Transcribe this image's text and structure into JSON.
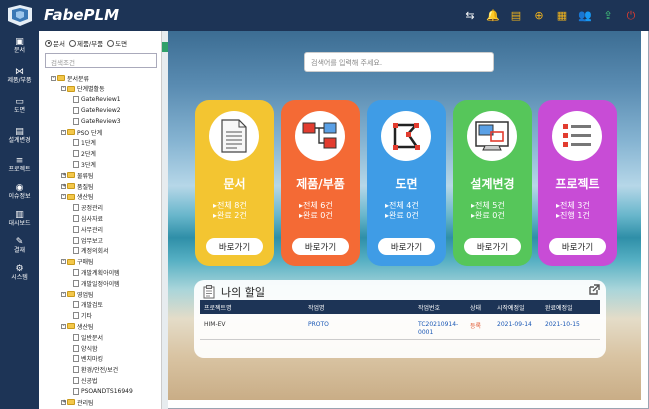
{
  "app": {
    "brand": "FabePLM"
  },
  "topbar": {
    "icons": [
      "swap-icon",
      "bell-icon",
      "clipboard-icon",
      "globe-icon",
      "calendar-icon",
      "user-group-icon",
      "export-icon",
      "power-icon"
    ],
    "icon_glyphs": [
      "⇆",
      "🔔",
      "▤",
      "⊕",
      "▦",
      "👥",
      "⇪",
      "⏻"
    ],
    "colors": {
      "bar": "#1d3456",
      "accent": "#f1b31c",
      "power": "#e23c2f"
    }
  },
  "rail": [
    {
      "label": "문서",
      "glyph": "▣"
    },
    {
      "label": "제품/부품",
      "glyph": "⋈"
    },
    {
      "label": "도면",
      "glyph": "▭"
    },
    {
      "label": "설계변경",
      "glyph": "▤"
    },
    {
      "label": "프로젝트",
      "glyph": "≡"
    },
    {
      "label": "이슈정보",
      "glyph": "◉"
    },
    {
      "label": "대시보드",
      "glyph": "▥"
    },
    {
      "label": "결재",
      "glyph": "✎"
    },
    {
      "label": "시스템",
      "glyph": "⚙"
    }
  ],
  "tree": {
    "radio_doc": "문서",
    "radio_part": "제품/부품",
    "radio_drawing": "도면",
    "search_placeholder": "검색조건",
    "nodes": [
      {
        "label": "문서분류",
        "type": "folder",
        "level": 0,
        "pm": "-"
      },
      {
        "label": "단계별활동",
        "type": "folder",
        "level": 1,
        "pm": "-"
      },
      {
        "label": "GateReview1",
        "type": "doc",
        "level": 2
      },
      {
        "label": "GateReview2",
        "type": "doc",
        "level": 2
      },
      {
        "label": "GateReview3",
        "type": "doc",
        "level": 2
      },
      {
        "label": "PSO 단계",
        "type": "folder",
        "level": 1,
        "pm": "-"
      },
      {
        "label": "1단계",
        "type": "doc",
        "level": 2
      },
      {
        "label": "2단계",
        "type": "doc",
        "level": 2
      },
      {
        "label": "3단계",
        "type": "doc",
        "level": 2
      },
      {
        "label": "물류팀",
        "type": "folder",
        "level": 1,
        "pm": "+"
      },
      {
        "label": "품질팀",
        "type": "folder",
        "level": 1,
        "pm": "+"
      },
      {
        "label": "생산팀",
        "type": "folder",
        "level": 1,
        "pm": "-"
      },
      {
        "label": "공정관리",
        "type": "doc",
        "level": 2
      },
      {
        "label": "심사자료",
        "type": "doc",
        "level": 2
      },
      {
        "label": "사무관리",
        "type": "doc",
        "level": 2
      },
      {
        "label": "업무보고",
        "type": "doc",
        "level": 2
      },
      {
        "label": "계정의회서",
        "type": "doc",
        "level": 2
      },
      {
        "label": "구매팀",
        "type": "folder",
        "level": 1,
        "pm": "-"
      },
      {
        "label": "개발계획아이템",
        "type": "doc",
        "level": 2
      },
      {
        "label": "개발일정아이템",
        "type": "doc",
        "level": 2
      },
      {
        "label": "영업팀",
        "type": "folder",
        "level": 1,
        "pm": "-"
      },
      {
        "label": "개발검토",
        "type": "doc",
        "level": 2
      },
      {
        "label": "기타",
        "type": "doc",
        "level": 2
      },
      {
        "label": "생산팀",
        "type": "folder",
        "level": 1,
        "pm": "-"
      },
      {
        "label": "일반문서",
        "type": "doc",
        "level": 2
      },
      {
        "label": "양식함",
        "type": "doc",
        "level": 2
      },
      {
        "label": "벤치마킹",
        "type": "doc",
        "level": 2
      },
      {
        "label": "환경/안전/보건",
        "type": "doc",
        "level": 2
      },
      {
        "label": "신공법",
        "type": "doc",
        "level": 2
      },
      {
        "label": "PSOANDTS16949",
        "type": "doc",
        "level": 2
      },
      {
        "label": "관리팀",
        "type": "folder",
        "level": 1,
        "pm": "+"
      }
    ]
  },
  "main": {
    "search_placeholder": "검색어를 입력해 주세요.",
    "cards": [
      {
        "title": "문서",
        "stat1": "▸전체 8건",
        "stat2": "▸완료 2건",
        "button": "바로가기",
        "icon": "document-icon",
        "color": "#f3c531"
      },
      {
        "title": "제품/부품",
        "stat1": "▸전체 6건",
        "stat2": "▸완료 0건",
        "button": "바로가기",
        "icon": "product-tree-icon",
        "color": "#f46a35"
      },
      {
        "title": "도면",
        "stat1": "▸전체 4건",
        "stat2": "▸완료 0건",
        "button": "바로가기",
        "icon": "drawing-icon",
        "color": "#3f9ce6"
      },
      {
        "title": "설계변경",
        "stat1": "▸전체 5건",
        "stat2": "▸완료 0건",
        "button": "바로가기",
        "icon": "design-change-icon",
        "color": "#56c65a"
      },
      {
        "title": "프로젝트",
        "stat1": "▸전체 3건",
        "stat2": "▸진행 1건",
        "button": "바로가기",
        "icon": "project-list-icon",
        "color": "#c84cd6"
      }
    ],
    "todo": {
      "title": "나의 할일",
      "headers": [
        "프로젝트명",
        "작업명",
        "작업번호",
        "상태",
        "시작예정일",
        "완료예정일"
      ],
      "rows": [
        {
          "project": "HIM-EV",
          "task": "PROTO",
          "task_no": "TC20210914-0001",
          "status": "등록",
          "start": "2021-09-14",
          "end": "2021-10-15"
        }
      ]
    }
  }
}
